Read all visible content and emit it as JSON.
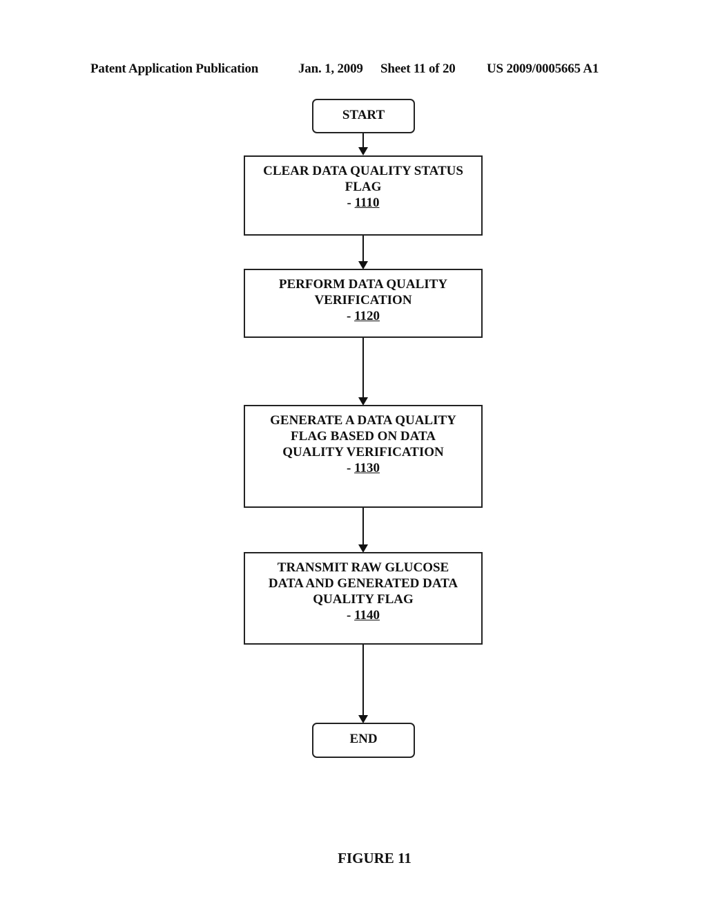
{
  "header": {
    "publication": "Patent Application Publication",
    "date": "Jan. 1, 2009",
    "sheet": "Sheet 11 of 20",
    "number": "US 2009/0005665 A1"
  },
  "flowchart": {
    "start": "START",
    "end": "END",
    "steps": [
      {
        "lines": [
          "CLEAR DATA QUALITY STATUS",
          "FLAG"
        ],
        "ref": "1110"
      },
      {
        "lines": [
          "PERFORM DATA QUALITY",
          "VERIFICATION"
        ],
        "ref": "1120"
      },
      {
        "lines": [
          "GENERATE A DATA QUALITY",
          "FLAG BASED ON DATA",
          "QUALITY VERIFICATION"
        ],
        "ref": "1130"
      },
      {
        "lines": [
          "TRANSMIT RAW GLUCOSE",
          "DATA AND GENERATED DATA",
          "QUALITY FLAG"
        ],
        "ref": "1140"
      }
    ],
    "ref_prefix": "- "
  },
  "figure_label": "FIGURE 11"
}
